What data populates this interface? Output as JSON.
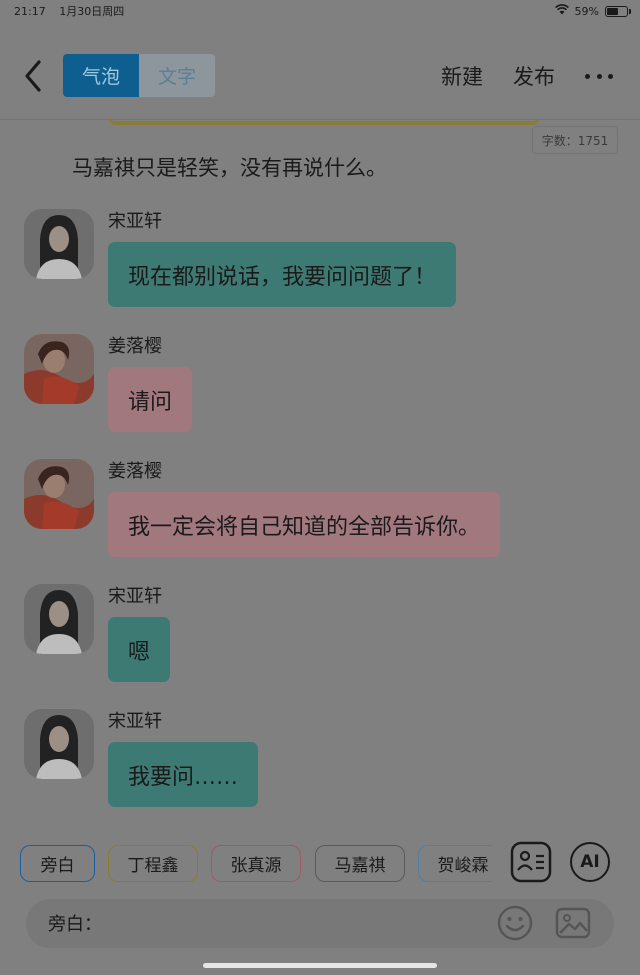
{
  "status_bar": {
    "time": "21:17",
    "date": "1月30日周四",
    "battery": "59%",
    "battery_level": 0.59
  },
  "header": {
    "tabs": [
      {
        "label": "气泡",
        "active": true
      },
      {
        "label": "文字",
        "active": false
      }
    ],
    "new_label": "新建",
    "publish_label": "发布"
  },
  "word_count": "字数：1751",
  "narration": "马嘉祺只是轻笑，没有再说什么。",
  "messages": [
    {
      "sender": "宋亚轩",
      "text": "现在都别说话，我要问问题了！",
      "color": "teal"
    },
    {
      "sender": "姜落樱",
      "text": "请问",
      "color": "pink"
    },
    {
      "sender": "姜落樱",
      "text": "我一定会将自己知道的全部告诉你。",
      "color": "pink"
    },
    {
      "sender": "宋亚轩",
      "text": "嗯",
      "color": "teal"
    },
    {
      "sender": "宋亚轩",
      "text": "我要问……",
      "color": "teal"
    }
  ],
  "characters": [
    {
      "label": "旁白",
      "color": "#1c5e9a"
    },
    {
      "label": "丁程鑫",
      "color": "#8c7a2e"
    },
    {
      "label": "张真源",
      "color": "#9a5c66"
    },
    {
      "label": "马嘉祺",
      "color": "#5a5a5a"
    },
    {
      "label": "贺峻霖",
      "color": "#4e7fa5"
    }
  ],
  "ai_label": "AI",
  "input": {
    "label": "旁白："
  },
  "colors": {
    "teal_bubble": "#3d7a73",
    "pink_bubble": "#a2787f",
    "active_tab": "#0e5f8f"
  }
}
